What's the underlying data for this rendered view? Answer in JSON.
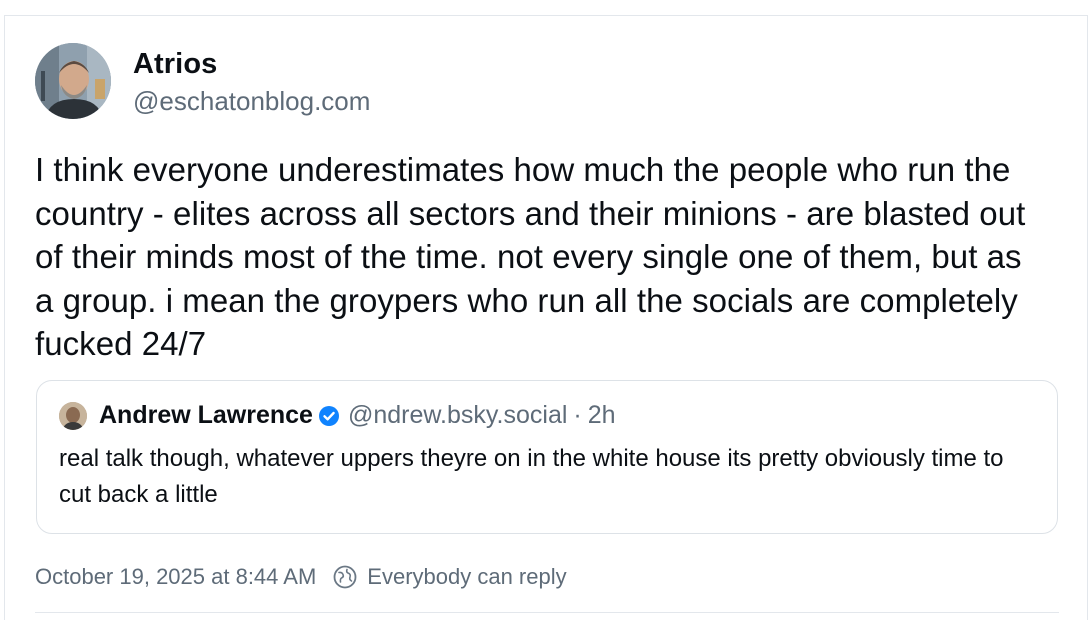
{
  "post": {
    "author": {
      "display_name": "Atrios",
      "handle": "@eschatonblog.com",
      "avatar_icon": "user-photo-avatar"
    },
    "text": "I think everyone underestimates how much the people who run the country - elites across all sectors and their minions - are blasted out of their minds most of the time. not every single one of them, but as a group. i mean the groypers who run all the socials are completely fucked 24/7",
    "quote": {
      "display_name": "Andrew Lawrence",
      "verified_icon": "verified-check-icon",
      "handle": "@ndrew.bsky.social",
      "separator": "·",
      "time": "2h",
      "text": "real talk though, whatever uppers theyre on in the white house its pretty obviously time to cut back a little"
    },
    "timestamp": "October 19, 2025 at 8:44 AM",
    "reply_icon": "globe-reply-icon",
    "reply_setting": "Everybody can reply"
  },
  "colors": {
    "text": "#0b0f14",
    "muted": "#5e6b78",
    "border": "#dde2e7",
    "verified": "#1083fe"
  }
}
